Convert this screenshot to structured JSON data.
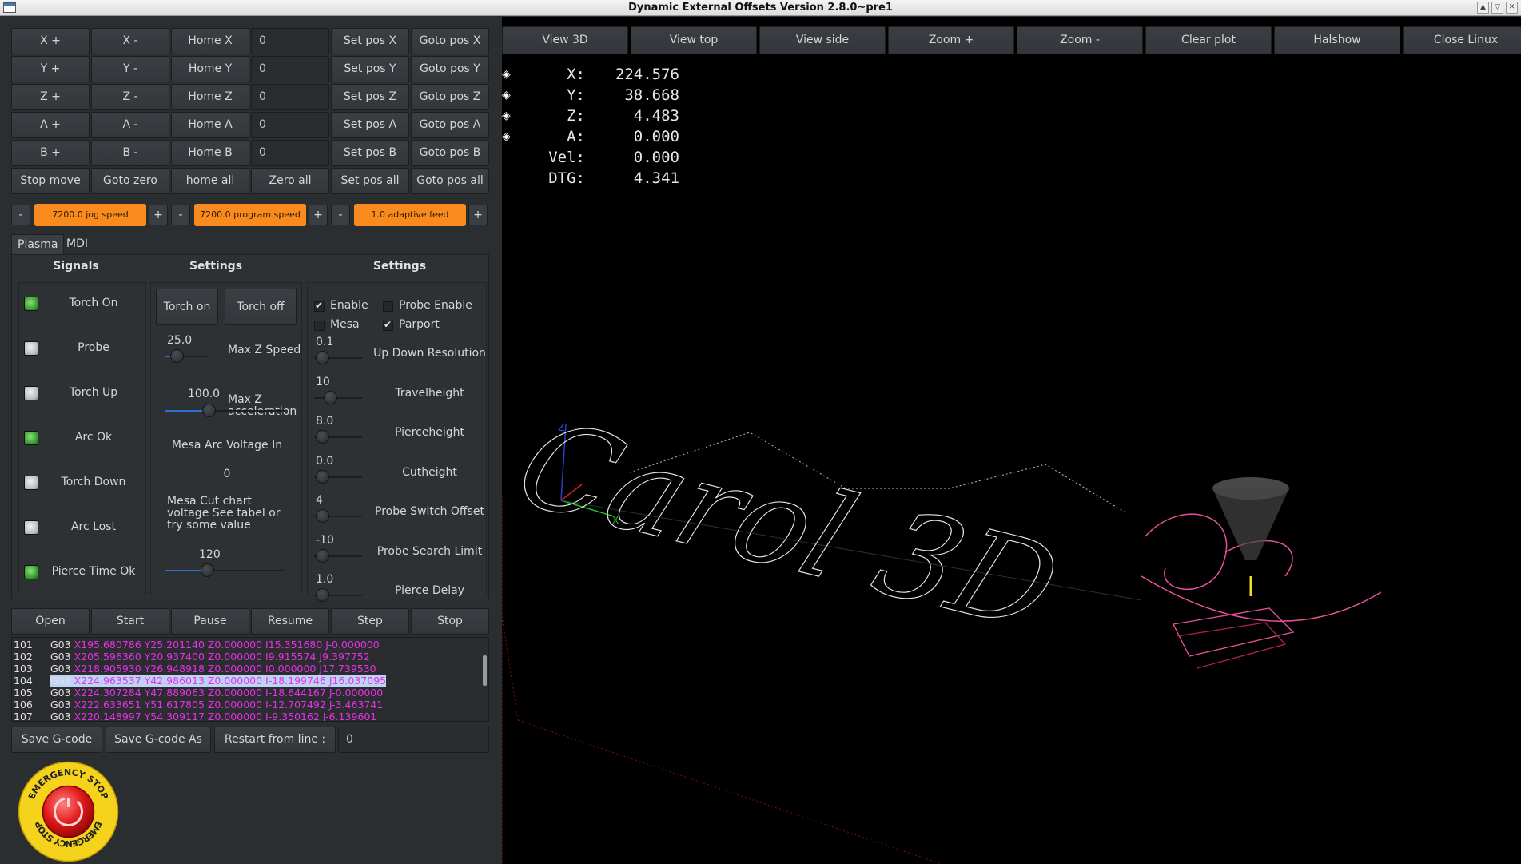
{
  "window": {
    "title": "Dynamic External Offsets Version 2.8.0~pre1"
  },
  "jog": {
    "rows": [
      {
        "plus": "X +",
        "minus": "X -",
        "home": "Home X",
        "value": "0",
        "set": "Set pos X",
        "goto": "Goto pos X"
      },
      {
        "plus": "Y +",
        "minus": "Y -",
        "home": "Home Y",
        "value": "0",
        "set": "Set pos Y",
        "goto": "Goto pos Y"
      },
      {
        "plus": "Z +",
        "minus": "Z -",
        "home": "Home Z",
        "value": "0",
        "set": "Set pos Z",
        "goto": "Goto pos Z"
      },
      {
        "plus": "A +",
        "minus": "A -",
        "home": "Home A",
        "value": "0",
        "set": "Set pos A",
        "goto": "Goto pos A"
      },
      {
        "plus": "B +",
        "minus": "B -",
        "home": "Home B",
        "value": "0",
        "set": "Set pos B",
        "goto": "Goto pos B"
      }
    ],
    "all_row": {
      "stop": "Stop move",
      "goto_zero": "Goto zero",
      "home_all": "home all",
      "zero_all": "Zero all",
      "set_all": "Set pos all",
      "goto_all": "Goto pos all"
    }
  },
  "speed": {
    "minus": "-",
    "plus": "+",
    "jog_speed": "7200.0 jog speed",
    "program_speed": "7200.0 program speed",
    "adaptive_feed": "1.0 adaptive feed",
    "accent": "#f98a1d"
  },
  "tabs": [
    {
      "label": "Plasma",
      "active": true
    },
    {
      "label": "MDI",
      "active": false
    }
  ],
  "plasma": {
    "signals_title": "Signals",
    "signals": [
      {
        "label": "Torch On",
        "on": true
      },
      {
        "label": "Probe",
        "on": false
      },
      {
        "label": "Torch Up",
        "on": false
      },
      {
        "label": "Arc Ok",
        "on": true
      },
      {
        "label": "Torch Down",
        "on": false
      },
      {
        "label": "Arc Lost",
        "on": false
      },
      {
        "label": "Pierce Time Ok",
        "on": true
      }
    ],
    "settings_title": "Settings",
    "torch_on": "Torch on",
    "torch_off": "Torch off",
    "max_z_speed": {
      "value": "25.0",
      "label": "Max Z Speed",
      "level": 0.1
    },
    "max_z_accel": {
      "value": "100.0",
      "label": "Max Z acceleration",
      "level": 0.95
    },
    "mesa_arc_label": "Mesa Arc Voltage In",
    "mesa_arc_value": "0",
    "mesa_cut_text": "Mesa Cut chart voltage See tabel or try some value",
    "mesa_cut_slider": {
      "value": "120",
      "level": 0.32
    },
    "settings2_title": "Settings",
    "checks": [
      {
        "label": "Enable",
        "checked": true
      },
      {
        "label": "Probe Enable",
        "checked": false
      },
      {
        "label": "Mesa",
        "checked": false
      },
      {
        "label": "Parport",
        "checked": true
      }
    ],
    "params": [
      {
        "value": "0.1",
        "label": "Up Down Resolution"
      },
      {
        "value": "10",
        "label": "Travelheight"
      },
      {
        "value": "8.0",
        "label": "Pierceheight"
      },
      {
        "value": "0.0",
        "label": "Cutheight"
      },
      {
        "value": "4",
        "label": "Probe Switch Offset"
      },
      {
        "value": "-10",
        "label": "Probe Search Limit"
      },
      {
        "value": "1.0",
        "label": "Pierce Delay"
      }
    ]
  },
  "program": {
    "open": "Open",
    "start": "Start",
    "pause": "Pause",
    "resume": "Resume",
    "step": "Step",
    "stop": "Stop"
  },
  "gcode": {
    "lines": [
      {
        "n": "101",
        "cmd": "G03",
        "args": "X195.680786 Y25.201140 Z0.000000 I15.351680 J-0.000000"
      },
      {
        "n": "102",
        "cmd": "G03",
        "args": "X205.596360 Y20.937400 Z0.000000 I9.915574 J9.397752"
      },
      {
        "n": "103",
        "cmd": "G03",
        "args": "X218.905930 Y26.948918 Z0.000000 I0.000000 J17.739530"
      },
      {
        "n": "104",
        "cmd": "G03",
        "args": "X224.963537 Y42.986013 Z0.000000 I-18.199746 J16.037095",
        "selected": true
      },
      {
        "n": "105",
        "cmd": "G03",
        "args": "X224.307284 Y47.889063 Z0.000000 I-18.644167 J-0.000000"
      },
      {
        "n": "106",
        "cmd": "G03",
        "args": "X222.633651 Y51.617805 Z0.000000 I-12.707492 J-3.463741"
      },
      {
        "n": "107",
        "cmd": "G03",
        "args": "X220.148997 Y54.309117 Z0.000000 I-9.350162 J-6.139601"
      }
    ]
  },
  "file": {
    "save": "Save G-code",
    "save_as": "Save G-code As",
    "restart": "Restart from line :",
    "restart_value": "0"
  },
  "estop": {
    "text": "EMERGENCY STOP"
  },
  "view": {
    "buttons": [
      "View 3D",
      "View top",
      "View side",
      "Zoom +",
      "Zoom -",
      "Clear plot",
      "Halshow",
      "Close Linux"
    ]
  },
  "dro": [
    {
      "axis": "X:",
      "value": "224.576"
    },
    {
      "axis": "Y:",
      "value": "38.668"
    },
    {
      "axis": "Z:",
      "value": "4.483"
    },
    {
      "axis": "A:",
      "value": "0.000"
    },
    {
      "axis": "Vel:",
      "value": "0.000"
    },
    {
      "axis": "DTG:",
      "value": "4.341"
    }
  ],
  "plot": {
    "text": "Carol 3D",
    "z_axis": "Z",
    "x_axis": "X"
  }
}
